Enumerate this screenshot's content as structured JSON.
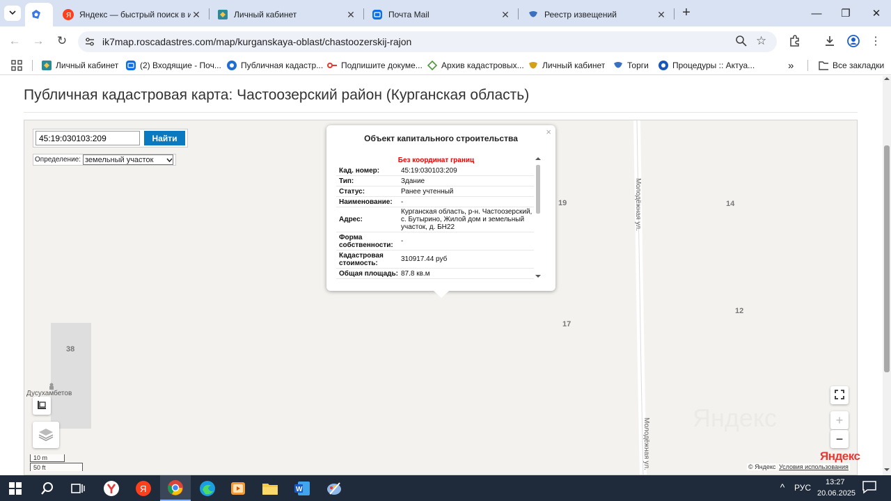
{
  "browser": {
    "tabs": [
      {
        "label": "Яндекс — быстрый поиск в ин",
        "active": false
      },
      {
        "label": "Личный кабинет",
        "active": false
      },
      {
        "label": "Почта Mail",
        "active": false
      },
      {
        "label": "Реестр извещений",
        "active": false
      }
    ],
    "new_tab": "+",
    "url": "ik7map.roscadastres.com/map/kurganskaya-oblast/chastoozerskij-rajon",
    "bookmarks": [
      "Личный кабинет",
      "(2) Входящие - Поч...",
      "Публичная кадастр...",
      "Подпишите докуме...",
      "Архив кадастровых...",
      "Личный кабинет",
      "Торги",
      "Процедуры :: Актуа..."
    ],
    "bookmarks_more": "»",
    "all_bookmarks": "Все закладки"
  },
  "page": {
    "title": "Публичная кадастровая карта: Частоозерский район (Курганская область)"
  },
  "map": {
    "search_value": "45:19:030103:209",
    "find_button": "Найти",
    "definition_label": "Определение:",
    "definition_value": "земельный участок",
    "labels": {
      "p19": "19",
      "p14": "14",
      "p17": "17",
      "p12": "12",
      "p38": "38"
    },
    "street_top": "Молодёжная ул.",
    "street_bottom": "Молодёжная ул.",
    "poi": "Дусухамбетов",
    "scale_m": "10 m",
    "scale_ft": "50 ft",
    "yandex_logo": "Яндекс",
    "copyright": "© Яндекс",
    "terms": "Условия использования",
    "zoom_in": "+",
    "zoom_out": "−",
    "watermark": "Яндекс"
  },
  "popup": {
    "title": "Объект капитального строительства",
    "warning": "Без координат границ",
    "close": "×",
    "rows": [
      {
        "k": "Кад. номер:",
        "v": "45:19:030103:209"
      },
      {
        "k": "Тип:",
        "v": "Здание"
      },
      {
        "k": "Статус:",
        "v": "Ранее учтенный"
      },
      {
        "k": "Наименование:",
        "v": "-"
      },
      {
        "k": "Адрес:",
        "v": "Курганская область, р-н. Частоозерский, с. Бутырино, Жилой дом и земельный участок, д. БН22"
      },
      {
        "k": "Форма собственности:",
        "v": "-"
      },
      {
        "k": "Кадастровая стоимость:",
        "v": "310917.44 руб"
      },
      {
        "k": "Общая площадь:",
        "v": "87.8 кв.м"
      }
    ]
  },
  "taskbar": {
    "lang": "РУС",
    "time": "13:27",
    "date": "20.06.2025"
  },
  "colors": {
    "tab_strip": "#d9e2f3",
    "find_button": "#0a79bf",
    "warning": "#ee0000",
    "taskbar": "#1f2a3a"
  }
}
